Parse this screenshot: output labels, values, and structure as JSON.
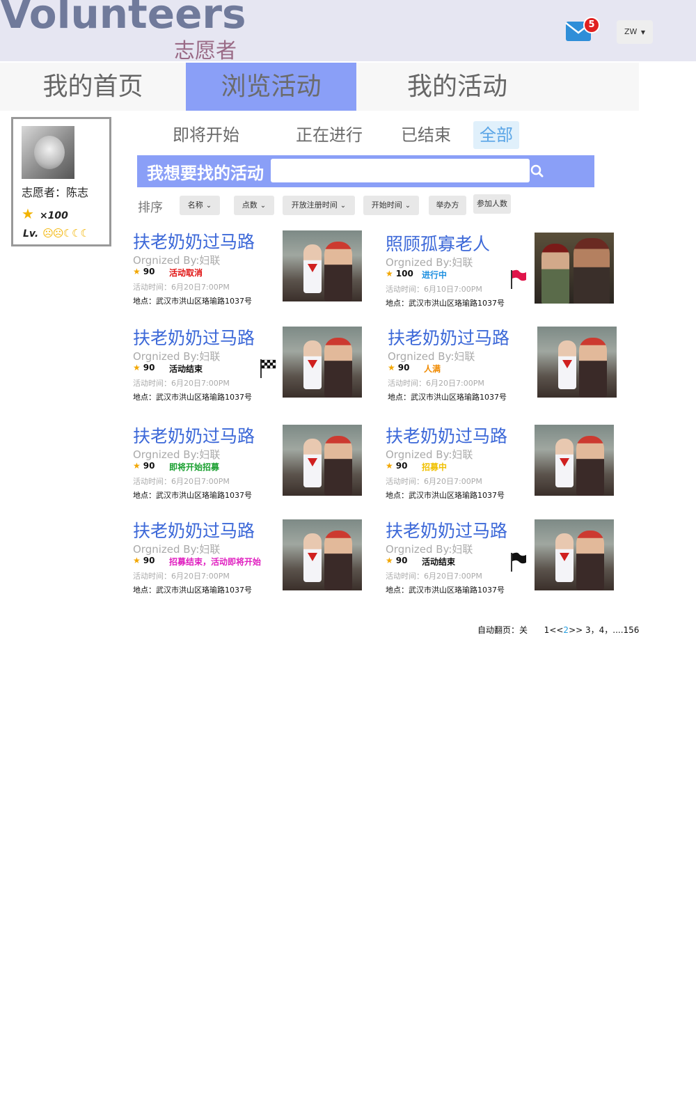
{
  "header": {
    "logo": "Volunteers",
    "logo_sub": "志愿者",
    "mail_count": "5",
    "user_label": "ZW"
  },
  "nav": {
    "tabs": [
      {
        "label": "我的首页"
      },
      {
        "label": "浏览活动"
      },
      {
        "label": "我的活动"
      }
    ]
  },
  "profile": {
    "name": "志愿者：陈志",
    "points": "×100",
    "level_label": "Lv."
  },
  "filters": [
    "即将开始",
    "正在进行",
    "已结束",
    "全部"
  ],
  "search": {
    "label": "我想要找的活动",
    "placeholder": ""
  },
  "sort": {
    "label": "排序",
    "options": [
      "名称",
      "点数",
      "开放注册时间",
      "开始时间",
      "举办方",
      "参加人数"
    ]
  },
  "activities": [
    {
      "title": "扶老奶奶过马路",
      "org": "Orgnized By:妇联",
      "points": "90",
      "status": "活动取消",
      "status_color": "#e01010",
      "time": "活动时间：6月20日7:00PM",
      "location": "地点：武汉市洪山区珞瑜路1037号",
      "flag": ""
    },
    {
      "title": "照顾孤寡老人",
      "org": "Orgnized By:妇联",
      "points": "100",
      "status": "进行中",
      "status_color": "#1e90e0",
      "time": "活动时间：6月10日7:00PM",
      "location": "地点：武汉市洪山区珞瑜路1037号",
      "flag": "red"
    },
    {
      "title": "扶老奶奶过马路",
      "org": "Orgnized By:妇联",
      "points": "90",
      "status": "活动结束",
      "status_color": "#111111",
      "time": "活动时间：6月20日7:00PM",
      "location": "地点：武汉市洪山区珞瑜路1037号",
      "flag": "checkered"
    },
    {
      "title": "扶老奶奶过马路",
      "org": "Orgnized By:妇联",
      "points": "90",
      "status": "人满",
      "status_color": "#f08a00",
      "time": "活动时间：6月20日7:00PM",
      "location": "地点：武汉市洪山区珞瑜路1037号",
      "flag": ""
    },
    {
      "title": "扶老奶奶过马路",
      "org": "Orgnized By:妇联",
      "points": "90",
      "status": "即将开始招募",
      "status_color": "#1aa030",
      "time": "活动时间：6月20日7:00PM",
      "location": "地点：武汉市洪山区珞瑜路1037号",
      "flag": ""
    },
    {
      "title": "扶老奶奶过马路",
      "org": "Orgnized By:妇联",
      "points": "90",
      "status": "招募中",
      "status_color": "#f0c000",
      "time": "活动时间：6月20日7:00PM",
      "location": "地点：武汉市洪山区珞瑜路1037号",
      "flag": ""
    },
    {
      "title": "扶老奶奶过马路",
      "org": "Orgnized By:妇联",
      "points": "90",
      "status": "招募结束，活动即将开始",
      "status_color": "#e020c0",
      "time": "活动时间：6月20日7:00PM",
      "location": "地点：武汉市洪山区珞瑜路1037号",
      "flag": ""
    },
    {
      "title": "扶老奶奶过马路",
      "org": "Orgnized By:妇联",
      "points": "90",
      "status": "活动结束",
      "status_color": "#111111",
      "time": "活动时间：6月20日7:00PM",
      "location": "地点：武汉市洪山区珞瑜路1037号",
      "flag": "black"
    }
  ],
  "pager": {
    "auto_label": "自动翻页：关",
    "first": "1",
    "prev": "<<",
    "current": "2",
    "next": ">>",
    "rest": "3，4，....156"
  }
}
